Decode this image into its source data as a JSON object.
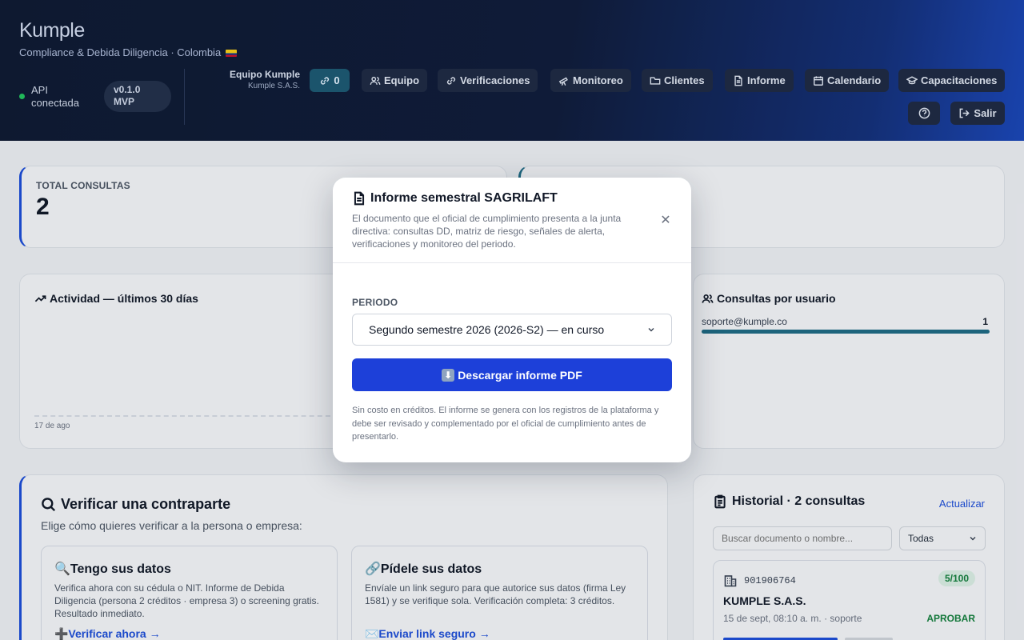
{
  "header": {
    "brand": "Kumple",
    "tagline": "Compliance & Debida Diligencia · Colombia",
    "api_status": "API conectada",
    "version": "v0.1.0 MVP",
    "team_name": "Equipo Kumple",
    "team_company": "Kumple S.A.S.",
    "links_count": "0",
    "nav": [
      {
        "label": "Equipo",
        "icon": "users-icon"
      },
      {
        "label": "Verificaciones",
        "icon": "link-icon"
      },
      {
        "label": "Monitoreo",
        "icon": "telescope-icon"
      },
      {
        "label": "Clientes",
        "icon": "folder-icon"
      },
      {
        "label": "Informe",
        "icon": "document-icon"
      },
      {
        "label": "Calendario",
        "icon": "calendar-icon"
      },
      {
        "label": "Capacitaciones",
        "icon": "graduation-cap-icon"
      }
    ],
    "logout_label": "Salir"
  },
  "stats": {
    "total_label": "TOTAL CONSULTAS",
    "total_value": "2"
  },
  "activity": {
    "title": "Actividad — últimos 30 días",
    "first_date": "17 de ago"
  },
  "usage": {
    "title": "Consultas por usuario",
    "rows": [
      {
        "user": "soporte@kumple.co",
        "count": "1",
        "fraction": 1.0
      }
    ]
  },
  "verify": {
    "title": "Verificar una contraparte",
    "subtitle": "Elige cómo quieres verificar a la persona o empresa:",
    "options": [
      {
        "title": "🔍Tengo sus datos",
        "description": "Verifica ahora con su cédula o NIT. Informe de Debida Diligencia (persona 2 créditos · empresa 3) o screening gratis. Resultado inmediato.",
        "action": "➕Verificar ahora →"
      },
      {
        "title": "🔗Pídele sus datos",
        "description": "Envíale un link seguro para que autorice sus datos (firma Ley 1581) y se verifique sola. Verificación completa: 3 créditos.",
        "action": "✉️Enviar link seguro →"
      }
    ]
  },
  "history": {
    "title": "Historial · 2 consultas",
    "refresh": "Actualizar",
    "search_placeholder": "Buscar documento o nombre...",
    "filter_value": "Todas",
    "items": [
      {
        "document": "901906764",
        "score": "5/100",
        "name": "KUMPLE S.A.S.",
        "meta": "15 de sept, 08:10 a. m. · soporte",
        "decision": "APROBAR"
      }
    ]
  },
  "modal": {
    "title": "Informe semestral SAGRILAFT",
    "description": "El documento que el oficial de cumplimiento presenta a la junta directiva: consultas DD, matriz de riesgo, señales de alerta, verificaciones y monitoreo del periodo.",
    "period_label": "PERIODO",
    "period_value": "Segundo semestre 2026 (2026-S2) — en curso",
    "download_label": "Descargar informe PDF",
    "note": "Sin costo en créditos. El informe se genera con los registros de la plataforma y debe ser revisado y complementado por el oficial de cumplimiento antes de presentarlo."
  },
  "colors": {
    "accent": "#1d40d9",
    "success": "#15803d",
    "header_dark": "#0f1a31"
  }
}
